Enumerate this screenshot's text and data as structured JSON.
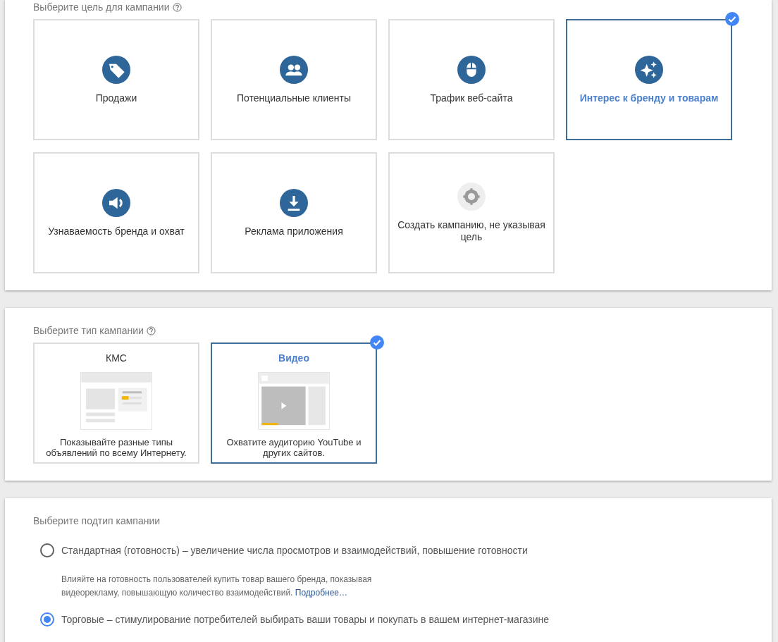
{
  "goal_section": {
    "heading": "Выберите цель для кампании",
    "goals": [
      {
        "label": "Продажи",
        "kind": "tag",
        "selected": false
      },
      {
        "label": "Потенциальные клиенты",
        "kind": "people",
        "selected": false
      },
      {
        "label": "Трафик веб-сайта",
        "kind": "mouse",
        "selected": false
      },
      {
        "label": "Интерес к бренду и товарам",
        "kind": "sparkle",
        "selected": true
      },
      {
        "label": "Узнаваемость бренда и охват",
        "kind": "volume",
        "selected": false
      },
      {
        "label": "Реклама приложения",
        "kind": "download",
        "selected": false
      },
      {
        "label": "Создать кампанию, не указывая цель",
        "kind": "gear",
        "selected": false
      }
    ]
  },
  "type_section": {
    "heading": "Выберите тип кампании",
    "types": [
      {
        "title": "КМС",
        "kind": "display",
        "description": "Показывайте разные типы объявлений по всему Интернету.",
        "selected": false
      },
      {
        "title": "Видео",
        "kind": "video",
        "description": "Охватите аудиторию YouTube и других сайтов.",
        "selected": true
      }
    ]
  },
  "subtype_section": {
    "heading": "Выберите подтип кампании",
    "options": [
      {
        "label": "Стандартная (готовность) – увеличение числа просмотров и взаимодействий, повышение готовности",
        "selected": false,
        "description": "Влияйте на готовность пользователей купить товар вашего бренда, показывая видеорекламу, повышающую количество взаимодействий.",
        "link": "Подробнее…"
      },
      {
        "label": "Торговые – стимулирование потребителей выбирать ваши товары и покупать в вашем интернет-магазине",
        "selected": true
      }
    ]
  }
}
